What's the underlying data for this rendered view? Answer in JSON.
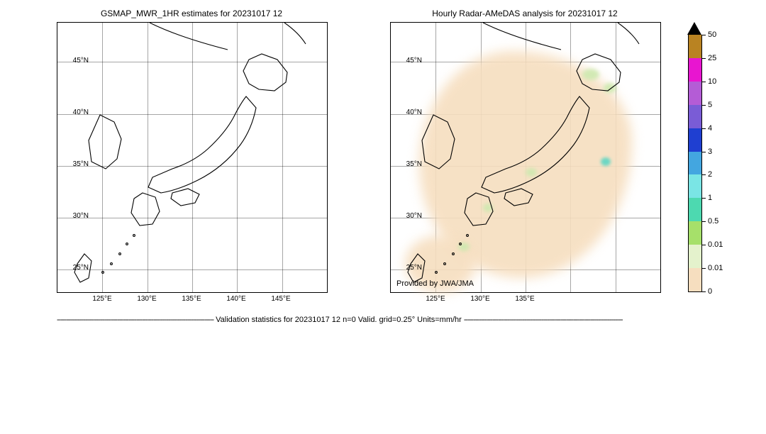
{
  "chart_data": [
    {
      "type": "heatmap",
      "title": "GSMAP_MWR_1HR estimates for 20231017 12",
      "xlabel": "",
      "ylabel": "",
      "x_ticks": [
        "125°E",
        "130°E",
        "135°E",
        "140°E",
        "145°E"
      ],
      "y_ticks": [
        "25°N",
        "30°N",
        "35°N",
        "40°N",
        "45°N"
      ],
      "xlim": [
        120,
        150
      ],
      "ylim": [
        22,
        48
      ],
      "region": "Japan",
      "series": [
        {
          "name": "precipitation",
          "values": "all zero — no data displayed"
        }
      ],
      "units": "mm/hr"
    },
    {
      "type": "heatmap",
      "title": "Hourly Radar-AMeDAS analysis for 20231017 12",
      "xlabel": "",
      "ylabel": "",
      "x_ticks": [
        "125°E",
        "130°E",
        "135°E"
      ],
      "y_ticks": [
        "25°N",
        "30°N",
        "35°N",
        "40°N",
        "45°N"
      ],
      "xlim": [
        120,
        150
      ],
      "ylim": [
        22,
        48
      ],
      "region": "Japan",
      "attribution": "Provided by JWA/JMA",
      "series": [
        {
          "name": "precipitation",
          "description": "Broad 0–0.01 mm/hr coverage over most of Japan (tan); small 0.01–0.5 mm/hr patches (pale green) near Hokkaido coast, Tohoku Pacific side, Chūbu, Kyushu, and Ryukyu Islands"
        }
      ],
      "units": "mm/hr"
    }
  ],
  "colorbar": {
    "ticks": [
      "0",
      "0.01",
      "0.5",
      "1",
      "2",
      "3",
      "4",
      "5",
      "10",
      "25",
      "50"
    ],
    "colors": [
      "#ffffff",
      "#f6debf",
      "#e4f2cc",
      "#a6e06a",
      "#4dd9b0",
      "#7ae5e5",
      "#43a6e0",
      "#1f3fd1",
      "#7a5cd6",
      "#b45cd6",
      "#e815d0",
      "#b98322"
    ],
    "top_arrow_color": "#000000",
    "units": "mm/hr"
  },
  "titles": {
    "left": "GSMAP_MWR_1HR estimates for 20231017 12",
    "right": "Hourly Radar-AMeDAS analysis for 20231017 12",
    "attribution": "Provided by JWA/JMA"
  },
  "axis": {
    "y": [
      "45°N",
      "40°N",
      "35°N",
      "30°N",
      "25°N"
    ],
    "x_left": [
      "125°E",
      "130°E",
      "135°E",
      "140°E",
      "145°E"
    ],
    "x_right": [
      "125°E",
      "130°E",
      "135°E"
    ]
  },
  "footer": {
    "text": "Validation statistics for 20231017 12  n=0 Valid. grid=0.25° Units=mm/hr"
  }
}
